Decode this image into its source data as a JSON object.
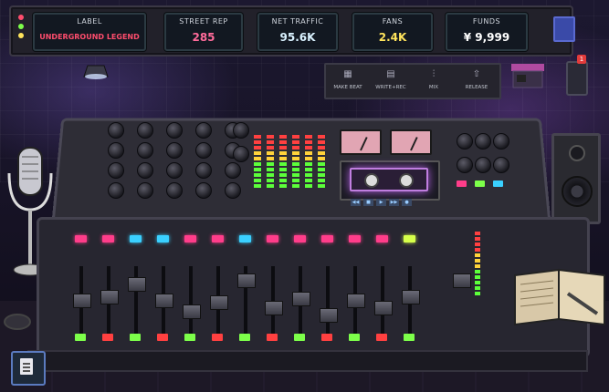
{
  "hud": {
    "stats": [
      {
        "label": "LABEL",
        "value": "UNDERGROUND LEGEND",
        "color": "#ff4d6d"
      },
      {
        "label": "STREET REP",
        "value": "285",
        "color": "#ff6b9a"
      },
      {
        "label": "NET TRAFFIC",
        "value": "95.6K",
        "color": "#d9f2ff"
      },
      {
        "label": "FANS",
        "value": "2.4K",
        "color": "#ffe45c"
      },
      {
        "label": "FUNDS",
        "value": "¥ 9,999",
        "color": "#ffffff"
      }
    ]
  },
  "actions": [
    {
      "label": "MAKE BEAT",
      "icon": "grid-icon"
    },
    {
      "label": "WRITE+REC",
      "icon": "notepad-icon"
    },
    {
      "label": "MIX",
      "icon": "sliders-icon"
    },
    {
      "label": "RELEASE",
      "icon": "upload-icon"
    }
  ],
  "notifications": {
    "badge": "1"
  },
  "colors": {
    "accent_pink": "#ff3d8a",
    "accent_cyan": "#3ad0ff",
    "accent_green": "#7dff4a",
    "accent_yellow": "#ffe45c",
    "accent_red": "#ff4040"
  }
}
